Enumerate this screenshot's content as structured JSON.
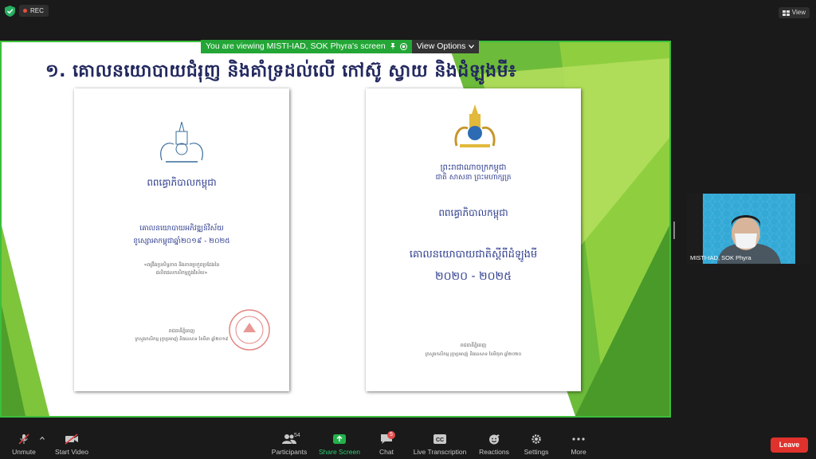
{
  "topbar": {
    "rec_label": "REC",
    "view_label": "View"
  },
  "banner": {
    "viewing_text": "You are viewing MISTI-IAD, SOK Phyra's screen",
    "view_options_label": "View Options"
  },
  "slide": {
    "title": "១. គោលនយោបាយជំរុញ និងគាំទ្រដល់លើ កៅស៊ូ ស្វាយ និងដំឡូងមី៖",
    "doc1": {
      "header": "ពពឝ្ធោភិបាលកម្ពុជា",
      "policy_title": "គោលនយោបាយអភិវឌ្ឍន៍វិស័យ",
      "subtitle": "ខូស្សោអាកម្ពុជាឆ្នាំ២០១៩ - ២០២៥",
      "note1": "«ពង្រឹងប្រសិទ្ធភាព និងភាពប្រកួតប្រជែងនៃ",
      "note2": "ផលិតផលកសិកម្មក្នុងវិស័យ»",
      "footer1": "រាជធានីភ្នំពេញ",
      "footer2": "ក្រសួងកសិកម្ម រុក្ខាប្រមាញ់ និងនេសាទ ខែមីនា ឆ្នាំ២០១៩"
    },
    "doc2": {
      "kingdom": "ព្រះរាជាណាចក្រកម្ពុជា",
      "motto": "ជាតិ សាសនា ព្រះមហាក្សត្រ",
      "header": "ពពឝ្ធោភិបាលកម្ពុជា",
      "policy_title": "គោលនយោបាយជាតិស្ដីពីដំឡូងមី",
      "years": "២០២០ - ២០២៥",
      "footer1": "រាជធានីភ្នំពេញ",
      "footer2": "ក្រសួងកសិកម្ម រុក្ខាប្រមាញ់ និងនេសាទ ខែមិថុនា ឆ្នាំ២០២០"
    }
  },
  "participant": {
    "name": "MISTI-IAD, SOK Phyra"
  },
  "toolbar": {
    "unmute": "Unmute",
    "start_video": "Start Video",
    "participants": "Participants",
    "participants_count": "54",
    "share_screen": "Share Screen",
    "chat": "Chat",
    "chat_badge": "5",
    "live_transcription": "Live Transcription",
    "reactions": "Reactions",
    "settings": "Settings",
    "more": "More",
    "leave": "Leave"
  },
  "colors": {
    "share_border": "#3cbf3c",
    "banner_green": "#23a636",
    "title_navy": "#22285e",
    "leave_red": "#e0322c"
  }
}
